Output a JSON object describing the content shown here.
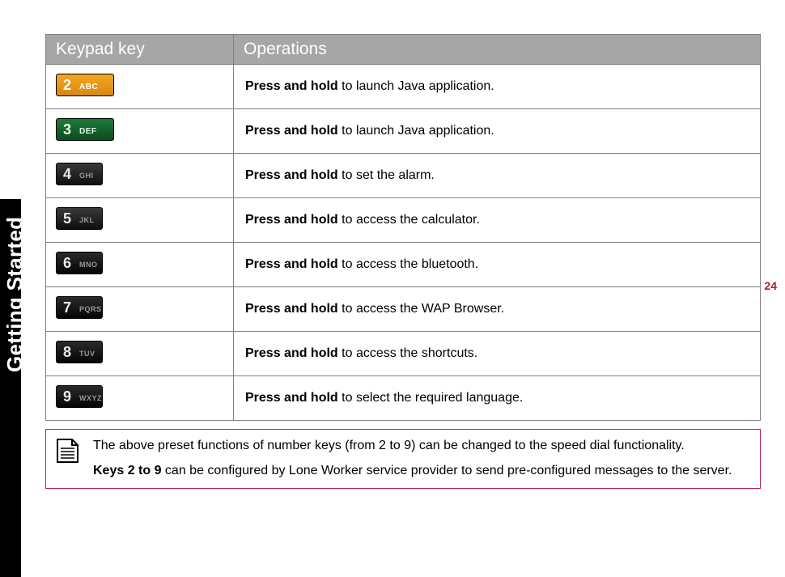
{
  "sidebar": {
    "label": "Getting Started"
  },
  "page_number": "24",
  "table": {
    "headers": {
      "col1": "Keypad key",
      "col2": "Operations"
    },
    "rows": [
      {
        "key_num": "2",
        "key_let": "ABC",
        "key_class": "k2",
        "prefix": "Press and hold",
        "rest": " to launch Java application."
      },
      {
        "key_num": "3",
        "key_let": "DEF",
        "key_class": "k3",
        "prefix": "Press and hold",
        "rest": " to launch Java application."
      },
      {
        "key_num": "4",
        "key_let": "GHI",
        "key_class": "kdark",
        "prefix": "Press and hold",
        "rest": " to set the alarm."
      },
      {
        "key_num": "5",
        "key_let": "JKL",
        "key_class": "kdark",
        "prefix": "Press and hold",
        "rest": " to access the calculator."
      },
      {
        "key_num": "6",
        "key_let": "MNO",
        "key_class": "kdark k6",
        "prefix": "Press and hold",
        "rest": " to access the bluetooth."
      },
      {
        "key_num": "7",
        "key_let": "PQRS",
        "key_class": "kdark k7",
        "prefix": "Press and hold",
        "rest": " to access the WAP Browser."
      },
      {
        "key_num": "8",
        "key_let": "TUV",
        "key_class": "kdark k8",
        "prefix": "Press and hold",
        "rest": " to access the shortcuts."
      },
      {
        "key_num": "9",
        "key_let": "WXYZ",
        "key_class": "kdark k9",
        "prefix": "Press and hold",
        "rest": " to select the required language."
      }
    ]
  },
  "note": {
    "line1": "The above preset functions of number keys (from 2 to 9) can be changed to the speed dial functionality.",
    "line2_bold": "Keys 2 to 9",
    "line2_rest": " can be configured by Lone Worker service provider to send pre-configured messages to the server."
  }
}
